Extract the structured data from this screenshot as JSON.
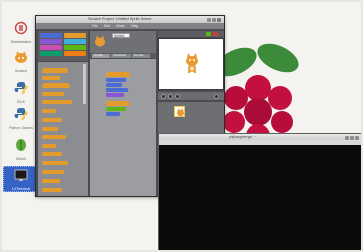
{
  "desktop": {
    "icons": [
      {
        "id": "trash",
        "label": "Wastebasket",
        "icon": "trash-icon"
      },
      {
        "id": "scratch",
        "label": "Scratch",
        "icon": "scratch-cat-icon"
      },
      {
        "id": "idle",
        "label": "IDLE",
        "icon": "python-idle-icon"
      },
      {
        "id": "python-games",
        "label": "Python Games",
        "icon": "python-games-icon"
      },
      {
        "id": "midori",
        "label": "Midori",
        "icon": "midori-icon"
      },
      {
        "id": "terminal",
        "label": "LXTerminal",
        "icon": "terminal-icon"
      }
    ],
    "wallpaper_logo": "raspberry-pi-logo"
  },
  "scratch": {
    "title": "Scratch Project: Untitled Sprite Scene",
    "menu": [
      "File",
      "Edit",
      "Share",
      "Help"
    ],
    "sprite_name": "Sprite1",
    "tabs": [
      "Scripts",
      "Costumes",
      "Sounds"
    ],
    "stage_label": "Stage",
    "colors": {
      "block_orange": "#e39b2d",
      "block_blue": "#4a6cd4",
      "block_green": "#5cb712",
      "block_purple": "#8a55d7",
      "panel_gray": "#4a4c50"
    }
  },
  "terminal": {
    "title": "pi@raspberrypi: ~",
    "background": "#000000"
  }
}
